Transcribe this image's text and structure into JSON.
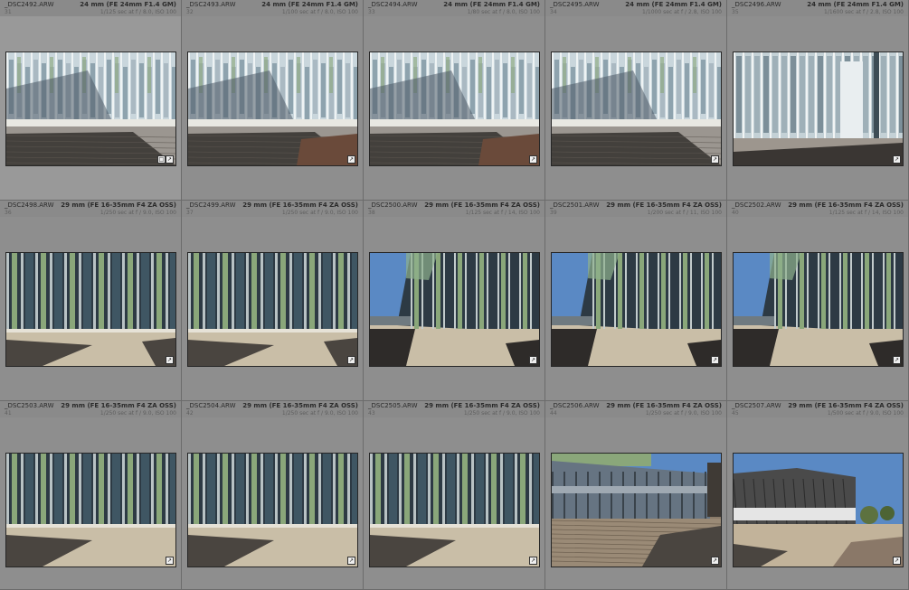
{
  "grid": {
    "cells": [
      {
        "file": "_DSC2492.ARW",
        "index": "31",
        "lens": "24 mm (FE 24mm F1.4 GM)",
        "exposure": "1/125 sec at f / 8.0, ISO 100",
        "scene": "facade-pale",
        "badges": [
          "crop-icon",
          "edit-icon"
        ]
      },
      {
        "file": "_DSC2493.ARW",
        "index": "32",
        "lens": "24 mm (FE 24mm F1.4 GM)",
        "exposure": "1/100 sec at f / 8.0, ISO 100",
        "scene": "facade-pale-ramp",
        "badges": [
          "edit-icon"
        ]
      },
      {
        "file": "_DSC2494.ARW",
        "index": "33",
        "lens": "24 mm (FE 24mm F1.4 GM)",
        "exposure": "1/80 sec at f / 8.0, ISO 100",
        "scene": "facade-pale-ramp",
        "badges": [
          "edit-icon"
        ]
      },
      {
        "file": "_DSC2495.ARW",
        "index": "34",
        "lens": "24 mm (FE 24mm F1.4 GM)",
        "exposure": "1/1000 sec at f / 2.8, ISO 100",
        "scene": "facade-pale",
        "badges": [
          "edit-icon"
        ]
      },
      {
        "file": "_DSC2496.ARW",
        "index": "35",
        "lens": "24 mm (FE 24mm F1.4 GM)",
        "exposure": "1/1600 sec at f / 2.8, ISO 100",
        "scene": "facade-corner",
        "badges": [
          "edit-icon"
        ]
      },
      {
        "file": "_DSC2498.ARW",
        "index": "36",
        "lens": "29 mm (FE 16-35mm F4 ZA OSS)",
        "exposure": "1/250 sec at f / 9.0, ISO 100",
        "scene": "facade-green",
        "badges": [
          "edit-icon"
        ]
      },
      {
        "file": "_DSC2499.ARW",
        "index": "37",
        "lens": "29 mm (FE 16-35mm F4 ZA OSS)",
        "exposure": "1/250 sec at f / 9.0, ISO 100",
        "scene": "facade-green",
        "badges": [
          "edit-icon"
        ]
      },
      {
        "file": "_DSC2500.ARW",
        "index": "38",
        "lens": "29 mm (FE 16-35mm F4 ZA OSS)",
        "exposure": "1/125 sec at f / 14, ISO 100",
        "scene": "facade-sky",
        "badges": [
          "edit-icon"
        ]
      },
      {
        "file": "_DSC2501.ARW",
        "index": "39",
        "lens": "29 mm (FE 16-35mm F4 ZA OSS)",
        "exposure": "1/200 sec at f / 11, ISO 100",
        "scene": "facade-sky",
        "badges": [
          "edit-icon"
        ]
      },
      {
        "file": "_DSC2502.ARW",
        "index": "40",
        "lens": "29 mm (FE 16-35mm F4 ZA OSS)",
        "exposure": "1/125 sec at f / 14, ISO 100",
        "scene": "facade-sky",
        "badges": [
          "edit-icon"
        ]
      },
      {
        "file": "_DSC2503.ARW",
        "index": "41",
        "lens": "29 mm (FE 16-35mm F4 ZA OSS)",
        "exposure": "1/250 sec at f / 9.0, ISO 100",
        "scene": "facade-green-tall",
        "badges": [
          "edit-icon"
        ]
      },
      {
        "file": "_DSC2504.ARW",
        "index": "42",
        "lens": "29 mm (FE 16-35mm F4 ZA OSS)",
        "exposure": "1/250 sec at f / 9.0, ISO 100",
        "scene": "facade-green-tall",
        "badges": [
          "edit-icon"
        ]
      },
      {
        "file": "_DSC2505.ARW",
        "index": "43",
        "lens": "29 mm (FE 16-35mm F4 ZA OSS)",
        "exposure": "1/250 sec at f / 9.0, ISO 100",
        "scene": "facade-green-tall",
        "badges": [
          "edit-icon"
        ]
      },
      {
        "file": "_DSC2506.ARW",
        "index": "44",
        "lens": "29 mm (FE 16-35mm F4 ZA OSS)",
        "exposure": "1/250 sec at f / 9.0, ISO 100",
        "scene": "glass-wing",
        "badges": [
          "edit-icon"
        ]
      },
      {
        "file": "_DSC2507.ARW",
        "index": "45",
        "lens": "29 mm (FE 16-35mm F4 ZA OSS)",
        "exposure": "1/500 sec at f / 9.0, ISO 100",
        "scene": "building-deck",
        "badges": [
          "edit-icon"
        ]
      }
    ]
  },
  "colors": {
    "sky": "#5a89c4",
    "sky_light": "#b9cbe0",
    "glass": "#2d3a44",
    "glass_pale": "#c9d6dc",
    "green_panel": "#8aa77a",
    "deck_dark": "#4a4540",
    "deck_light": "#c9bea7",
    "shadow": "#3a3633",
    "ramp": "#6a4a3a"
  }
}
